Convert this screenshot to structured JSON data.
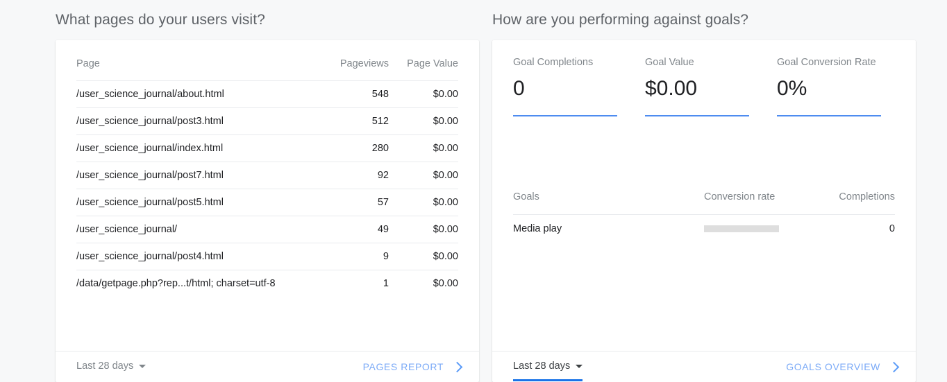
{
  "pages_panel": {
    "title": "What pages do your users visit?",
    "columns": [
      "Page",
      "Pageviews",
      "Page Value"
    ],
    "rows": [
      {
        "page": "/user_science_journal/about.html",
        "pageviews": "548",
        "page_value": "$0.00"
      },
      {
        "page": "/user_science_journal/post3.html",
        "pageviews": "512",
        "page_value": "$0.00"
      },
      {
        "page": "/user_science_journal/index.html",
        "pageviews": "280",
        "page_value": "$0.00"
      },
      {
        "page": "/user_science_journal/post7.html",
        "pageviews": "92",
        "page_value": "$0.00"
      },
      {
        "page": "/user_science_journal/post5.html",
        "pageviews": "57",
        "page_value": "$0.00"
      },
      {
        "page": "/user_science_journal/",
        "pageviews": "49",
        "page_value": "$0.00"
      },
      {
        "page": "/user_science_journal/post4.html",
        "pageviews": "9",
        "page_value": "$0.00"
      },
      {
        "page": "/data/getpage.php?rep...t/html; charset=utf-8",
        "pageviews": "1",
        "page_value": "$0.00"
      }
    ],
    "footer": {
      "date_range": "Last 28 days",
      "report_link": "PAGES REPORT"
    }
  },
  "goals_panel": {
    "title": "How are you performing against goals?",
    "metrics": [
      {
        "label": "Goal Completions",
        "value": "0"
      },
      {
        "label": "Goal Value",
        "value": "$0.00"
      },
      {
        "label": "Goal Conversion Rate",
        "value": "0%"
      }
    ],
    "columns": [
      "Goals",
      "Conversion rate",
      "Completions"
    ],
    "rows": [
      {
        "goal": "Media play",
        "conversion_rate": "",
        "completions": "0"
      }
    ],
    "footer": {
      "date_range": "Last 28 days",
      "report_link": "GOALS OVERVIEW"
    }
  },
  "colors": {
    "accent_blue": "#1a73e8",
    "link_blue": "#7baaf7",
    "sparkline_blue": "#4e8cf0",
    "bar_grey": "#dedede",
    "page_bg": "#f7f8f9",
    "card_bg": "#ffffff",
    "muted_text": "#80868b"
  },
  "chart_data": {
    "type": "line",
    "title": "Goal metric sparklines",
    "xlabel": "",
    "ylabel": "",
    "grid": false,
    "legend": "none",
    "series": [
      {
        "name": "Goal Completions",
        "values": [
          0,
          0,
          0,
          0,
          0,
          0,
          0,
          0,
          0,
          0,
          0,
          0,
          0,
          0
        ]
      },
      {
        "name": "Goal Value",
        "values": [
          0,
          0,
          0,
          0,
          0,
          0,
          0,
          0,
          0,
          0,
          0,
          0,
          0,
          0
        ]
      },
      {
        "name": "Goal Conversion Rate",
        "values": [
          0,
          0,
          0,
          0,
          0,
          0,
          0,
          0,
          0,
          0,
          0,
          0,
          0,
          0
        ]
      }
    ],
    "ylim": [
      0,
      1
    ]
  }
}
